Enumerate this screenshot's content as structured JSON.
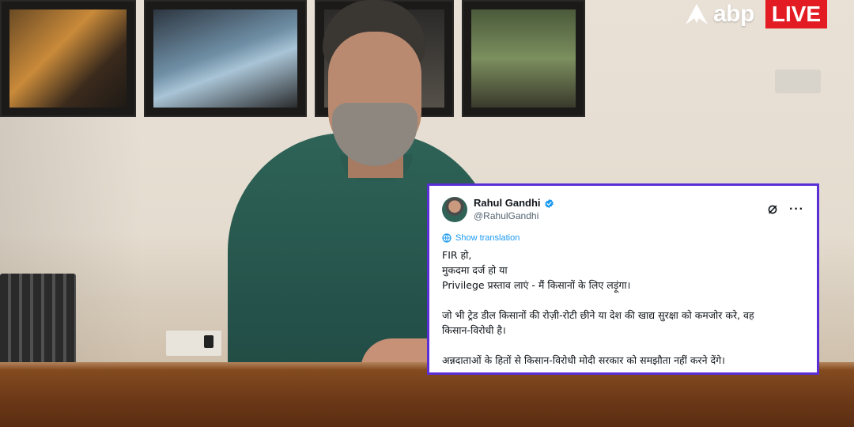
{
  "brand": {
    "logo_text": "abp",
    "live_label": "LIVE",
    "logo_color": "#ffffff",
    "live_color": "#e31b23",
    "logo_icon": "abp-triangle-logo"
  },
  "tweet": {
    "display_name": "Rahul Gandhi",
    "handle": "@RahulGandhi",
    "verified_icon": "verified-badge-icon",
    "show_translation": "Show translation",
    "border_color": "#5b2fd6",
    "link_color": "#1d9bf0",
    "lines": [
      "FIR हो,",
      "मुकदमा दर्ज हो या",
      "Privilege प्रस्ताव लाएं - मैं किसानों के लिए लड़ूंगा।",
      "",
      "जो भी ट्रेड डील किसानों की रोज़ी-रोटी छीने या देश की खाद्य सुरक्षा को कमजोर करे, वह",
      "किसान-विरोधी है।",
      "",
      "अन्नदाताओं के हितों से किसान-विरोधी मोदी सरकार को समझौता नहीं करने देंगे।"
    ],
    "actions": {
      "grok_icon": "grok-icon",
      "more_icon": "more-options-icon",
      "more_label": "···"
    }
  }
}
